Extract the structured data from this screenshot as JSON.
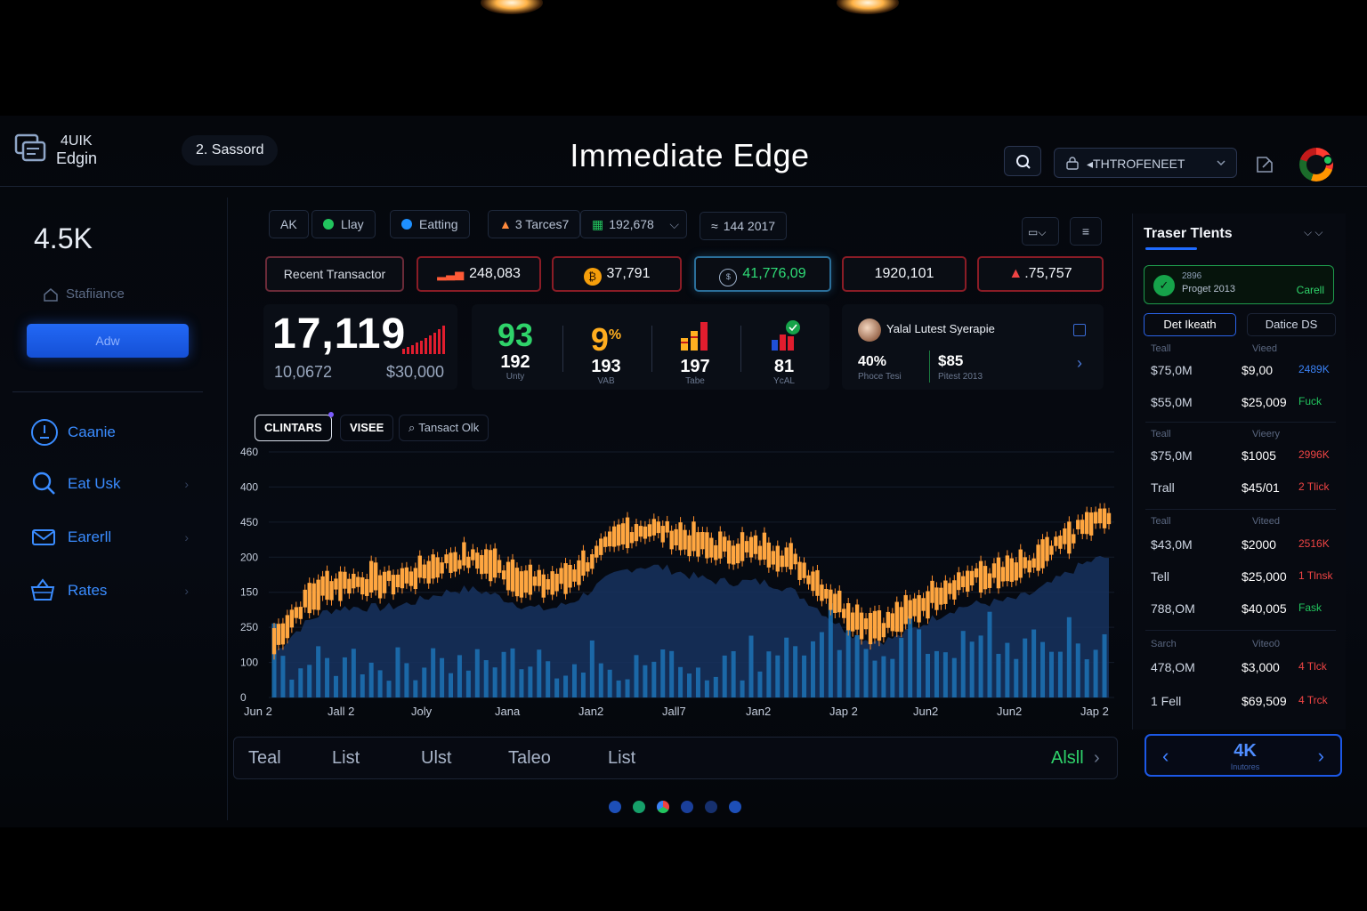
{
  "header": {
    "logo_line1": "4UIK",
    "logo_line2": "Edgin",
    "session": "2. Sassord",
    "title": "Immediate Edge",
    "account": "◂THTROFENEET"
  },
  "sidebar": {
    "big_value": "4.5K",
    "home_label": "Stafiiance",
    "add_button": "Adw",
    "items": [
      {
        "label": "Caanie",
        "icon": "clock-icon"
      },
      {
        "label": "Eat Usk",
        "icon": "search-icon"
      },
      {
        "label": "Earerll",
        "icon": "mail-icon"
      },
      {
        "label": "Rates",
        "icon": "basket-icon"
      }
    ]
  },
  "toolbar": {
    "chips": [
      "AK",
      "Llay",
      "Eatting",
      "3 Tarces7",
      "192,678",
      "144 2017"
    ],
    "chip_colors": {
      "llay": "#22c55e",
      "eatting": "#1e90ff"
    }
  },
  "stats": {
    "recent": "Recent Transactor",
    "s1": "248,083",
    "s2": "37,791",
    "s3": "41,776,09",
    "s4": "1920,101",
    "s5": ".75,757"
  },
  "kpi": {
    "main": "17,119",
    "sub_left": "10,0672",
    "sub_right": "$30,000"
  },
  "metrics": [
    {
      "big": "93",
      "num": "192",
      "cap": "Unty",
      "color": "#2fd36a"
    },
    {
      "big": "9",
      "sup": "%",
      "num": "193",
      "cap": "VAB",
      "color": "#ffad1f"
    },
    {
      "num": "197",
      "cap": "Tabe"
    },
    {
      "num": "81",
      "cap": "YcAL"
    }
  ],
  "profile": {
    "name": "Yalal Lutest Syerapie",
    "pct": "40%",
    "pct_caption": "Phoce Tesi",
    "price": "$85",
    "price_caption": "Pitest 2013"
  },
  "chart_tabs": [
    "CLINTARS",
    "VISEE",
    "Tansact Olk"
  ],
  "chart_data": {
    "type": "candlestick",
    "y_ticks": [
      "460",
      "400",
      "450",
      "200",
      "150",
      "250",
      "100",
      "0"
    ],
    "x_ticks": [
      "Jun 2",
      "Jall 2",
      "Joly",
      "Jana",
      "Jan2",
      "Jall7",
      "Jan2",
      "Jap 2",
      "Jun2",
      "Jun2",
      "Jap 2"
    ],
    "colors": {
      "candle": "#ffa640",
      "area": "#17335f",
      "volume": "#1c6fb0"
    }
  },
  "bottom_bar": {
    "items": [
      "Teal",
      "List",
      "Ulst",
      "Taleo",
      "List"
    ],
    "all": "Alsll"
  },
  "right_panel": {
    "title": "Traser Tlents",
    "card_line1": "2896",
    "card_line2": "Proget 2013",
    "card_action": "Carell",
    "tab1": "Det Ikeath",
    "tab2": "Datice DS",
    "groups": [
      {
        "head": [
          "Teall",
          "Vieed"
        ],
        "rows": [
          [
            "$75,0M",
            "$9,00",
            "2489K",
            "#3b82f6"
          ],
          [
            "$55,0M",
            "$25,009",
            "Fuck",
            "#22c55e"
          ]
        ]
      },
      {
        "head": [
          "Teall",
          "Vieery"
        ],
        "rows": [
          [
            "$75,0M",
            "$1005",
            "2996K",
            "#ef4444"
          ],
          [
            "Trall",
            "$45/01",
            "2 Tlick",
            "#ef4444"
          ]
        ]
      },
      {
        "head": [
          "Teall",
          "Viteed"
        ],
        "rows": [
          [
            "$43,0M",
            "$2000",
            "2516K",
            "#ef4444"
          ],
          [
            "Tell",
            "$25,000",
            "1 Tlnsk",
            "#ef4444"
          ],
          [
            "788,OM",
            "$40,005",
            "Fask",
            "#22c55e"
          ]
        ]
      },
      {
        "head": [
          "Sarch",
          "Viteo0"
        ],
        "rows": [
          [
            "478,OM",
            "$3,000",
            "4 Tlck",
            "#ef4444"
          ],
          [
            "1 Fell",
            "$69,509",
            "4 Trck",
            "#ef4444"
          ]
        ]
      }
    ]
  },
  "pager": {
    "value": "4K",
    "caption": "Inutores"
  }
}
